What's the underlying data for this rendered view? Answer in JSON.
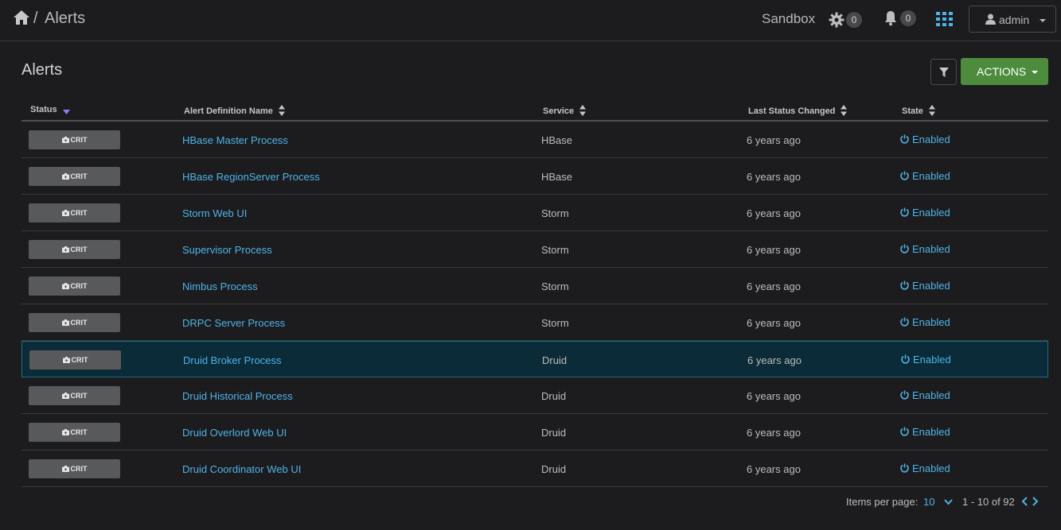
{
  "header": {
    "breadcrumb_separator": "/",
    "breadcrumb_current": "Alerts",
    "cluster_name": "Sandbox",
    "ops_count": "0",
    "alerts_count": "0",
    "user_label": "admin"
  },
  "page": {
    "title": "Alerts",
    "actions_label": "ACTIONS"
  },
  "table": {
    "columns": {
      "status": "Status",
      "name": "Alert Definition Name",
      "service": "Service",
      "last_changed": "Last Status Changed",
      "state": "State"
    },
    "rows": [
      {
        "status": "CRIT",
        "name": "HBase Master Process",
        "service": "HBase",
        "last_changed": "6 years ago",
        "state": "Enabled",
        "selected": false
      },
      {
        "status": "CRIT",
        "name": "HBase RegionServer Process",
        "service": "HBase",
        "last_changed": "6 years ago",
        "state": "Enabled",
        "selected": false
      },
      {
        "status": "CRIT",
        "name": "Storm Web UI",
        "service": "Storm",
        "last_changed": "6 years ago",
        "state": "Enabled",
        "selected": false
      },
      {
        "status": "CRIT",
        "name": "Supervisor Process",
        "service": "Storm",
        "last_changed": "6 years ago",
        "state": "Enabled",
        "selected": false
      },
      {
        "status": "CRIT",
        "name": "Nimbus Process",
        "service": "Storm",
        "last_changed": "6 years ago",
        "state": "Enabled",
        "selected": false
      },
      {
        "status": "CRIT",
        "name": "DRPC Server Process",
        "service": "Storm",
        "last_changed": "6 years ago",
        "state": "Enabled",
        "selected": false
      },
      {
        "status": "CRIT",
        "name": "Druid Broker Process",
        "service": "Druid",
        "last_changed": "6 years ago",
        "state": "Enabled",
        "selected": true
      },
      {
        "status": "CRIT",
        "name": "Druid Historical Process",
        "service": "Druid",
        "last_changed": "6 years ago",
        "state": "Enabled",
        "selected": false
      },
      {
        "status": "CRIT",
        "name": "Druid Overlord Web UI",
        "service": "Druid",
        "last_changed": "6 years ago",
        "state": "Enabled",
        "selected": false
      },
      {
        "status": "CRIT",
        "name": "Druid Coordinator Web UI",
        "service": "Druid",
        "last_changed": "6 years ago",
        "state": "Enabled",
        "selected": false
      }
    ]
  },
  "pagination": {
    "items_per_page_label": "Items per page:",
    "items_per_page_value": "10",
    "range_text": "1 - 10 of 92"
  },
  "colors": {
    "background": "#1c1c1e",
    "link": "#4fb3e8",
    "actions_green": "#4c8c3c",
    "crit_badge": "#58595b",
    "selected_row": "#0b2b38"
  },
  "icons": {
    "home": "home-icon",
    "gear": "gear-icon",
    "bell": "bell-icon",
    "apps": "grid-icon",
    "user": "user-icon",
    "filter": "filter-icon",
    "crit": "crit-icon",
    "power": "power-icon"
  }
}
